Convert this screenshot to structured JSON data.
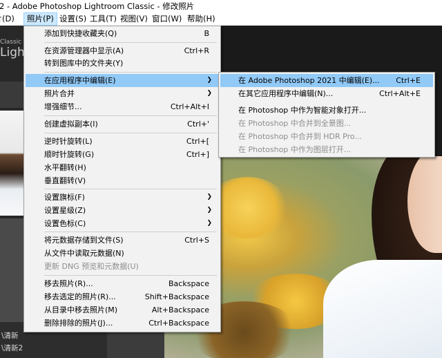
{
  "window": {
    "title": "2 - Adobe Photoshop Lightroom Classic - 修改照片"
  },
  "menubar": [
    {
      "label": "照片(D)"
    },
    {
      "label": "照片(P)"
    },
    {
      "label": "设置(S)"
    },
    {
      "label": "工具(T)"
    },
    {
      "label": "视图(V)"
    },
    {
      "label": "窗口(W)"
    },
    {
      "label": "帮助(H)"
    }
  ],
  "background": {
    "logo_small": "Classic",
    "logo_big": "Lightr",
    "collection_1": "\\清新",
    "collection_2": "\\清新2"
  },
  "photo_menu": {
    "items": [
      {
        "label": "添加到快捷收藏夹(Q)",
        "shortcut": "B"
      },
      {
        "label": "在资源管理器中显示(A)",
        "shortcut": "Ctrl+R"
      },
      {
        "label": "转到图库中的文件夹(Y)",
        "shortcut": ""
      },
      {
        "label": "在应用程序中编辑(E)",
        "shortcut": "",
        "submenu": true,
        "highlighted": true
      },
      {
        "label": "照片合并",
        "shortcut": "",
        "submenu": true
      },
      {
        "label": "增强细节...",
        "shortcut": "Ctrl+Alt+I"
      },
      {
        "label": "创建虚拟副本(I)",
        "shortcut": "Ctrl+'"
      },
      {
        "label": "逆时针旋转(L)",
        "shortcut": "Ctrl+["
      },
      {
        "label": "顺时针旋转(G)",
        "shortcut": "Ctrl+]"
      },
      {
        "label": "水平翻转(H)",
        "shortcut": ""
      },
      {
        "label": "垂直翻转(V)",
        "shortcut": ""
      },
      {
        "label": "设置旗标(F)",
        "shortcut": "",
        "submenu": true
      },
      {
        "label": "设置星级(Z)",
        "shortcut": "",
        "submenu": true
      },
      {
        "label": "设置色标(C)",
        "shortcut": "",
        "submenu": true
      },
      {
        "label": "将元数据存储到文件(S)",
        "shortcut": "Ctrl+S"
      },
      {
        "label": "从文件中读取元数据(N)",
        "shortcut": ""
      },
      {
        "label": "更新 DNG 预览和元数据(U)",
        "shortcut": "",
        "disabled": true
      },
      {
        "label": "移去照片(R)...",
        "shortcut": "Backspace"
      },
      {
        "label": "移去选定的照片(R)...",
        "shortcut": "Shift+Backspace"
      },
      {
        "label": "从目录中移去照片(M)",
        "shortcut": "Alt+Backspace"
      },
      {
        "label": "删除排除的照片(J)...",
        "shortcut": "Ctrl+Backspace"
      }
    ]
  },
  "edit_in_submenu": {
    "items": [
      {
        "label": "在 Adobe Photoshop 2021 中编辑(E)...",
        "shortcut": "Ctrl+E",
        "highlighted": true
      },
      {
        "label": "在其它应用程序中编辑(N)...",
        "shortcut": "Ctrl+Alt+E"
      },
      {
        "label": "在 Photoshop 中作为智能对象打开...",
        "shortcut": ""
      },
      {
        "label": "在 Photoshop 中合并到全景图...",
        "shortcut": "",
        "disabled": true
      },
      {
        "label": "在 Photoshop 中合并到 HDR Pro...",
        "shortcut": "",
        "disabled": true
      },
      {
        "label": "在 Photoshop 中作为图层打开...",
        "shortcut": "",
        "disabled": true
      }
    ]
  }
}
